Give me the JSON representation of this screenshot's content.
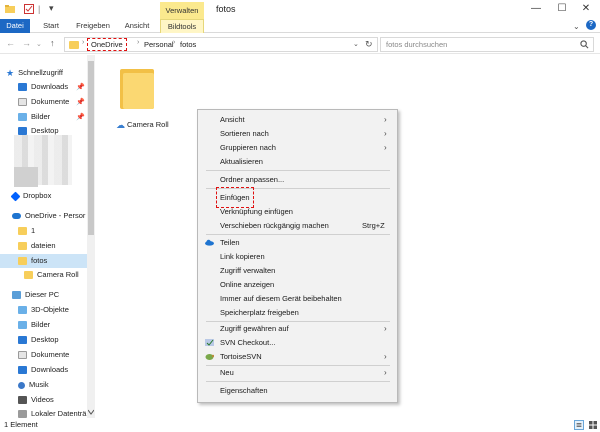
{
  "window": {
    "title": "fotos",
    "context_tab_group": "Verwalten",
    "min_symbol": "—",
    "max_symbol": "☐",
    "close_symbol": "✕"
  },
  "quick_access": {
    "sep": "|",
    "more": "▾"
  },
  "ribbon": {
    "tabs": [
      "Datei",
      "Start",
      "Freigeben",
      "Ansicht",
      "Bildtools"
    ],
    "collapse_symbol": "⌄",
    "help_symbol": "?"
  },
  "nav": {
    "back": "←",
    "forward": "→",
    "history": "⌄",
    "up": "↑"
  },
  "address": {
    "crumbs": [
      "OneDrive",
      "Personal",
      "fotos"
    ],
    "arrow": "›",
    "dropdown": "⌄",
    "refresh": "↻"
  },
  "search": {
    "placeholder": "fotos durchsuchen"
  },
  "sidebar": {
    "items": [
      {
        "label": "Schnellzugriff"
      },
      {
        "label": "Downloads"
      },
      {
        "label": "Dokumente"
      },
      {
        "label": "Bilder"
      },
      {
        "label": "Desktop"
      },
      {
        "label": "Dropbox"
      },
      {
        "label": "OneDrive - Persor"
      },
      {
        "label": "1"
      },
      {
        "label": "dateien"
      },
      {
        "label": "fotos"
      },
      {
        "label": "Camera Roll"
      },
      {
        "label": "Dieser PC"
      },
      {
        "label": "3D-Objekte"
      },
      {
        "label": "Bilder"
      },
      {
        "label": "Desktop"
      },
      {
        "label": "Dokumente"
      },
      {
        "label": "Downloads"
      },
      {
        "label": "Musik"
      },
      {
        "label": "Videos"
      },
      {
        "label": "Lokaler Datenträ"
      }
    ],
    "pin": "📌",
    "star": "★"
  },
  "content": {
    "files": [
      {
        "name": "Camera Roll"
      }
    ],
    "cloud_symbol": "☁"
  },
  "context_menu": {
    "items": [
      {
        "label": "Ansicht"
      },
      {
        "label": "Sortieren nach"
      },
      {
        "label": "Gruppieren nach"
      },
      {
        "label": "Aktualisieren"
      },
      {
        "label": "Ordner anpassen..."
      },
      {
        "label": "Einfügen"
      },
      {
        "label": "Verknüpfung einfügen"
      },
      {
        "label": "Verschieben rückgängig machen",
        "shortcut": "Strg+Z"
      },
      {
        "label": "Teilen"
      },
      {
        "label": "Link kopieren"
      },
      {
        "label": "Zugriff verwalten"
      },
      {
        "label": "Online anzeigen"
      },
      {
        "label": "Immer auf diesem Gerät beibehalten"
      },
      {
        "label": "Speicherplatz freigeben"
      },
      {
        "label": "Zugriff gewähren auf"
      },
      {
        "label": "SVN Checkout..."
      },
      {
        "label": "TortoiseSVN"
      },
      {
        "label": "Neu"
      },
      {
        "label": "Eigenschaften"
      }
    ],
    "arrow": "›"
  },
  "status": {
    "text": "1 Element"
  },
  "colors": {
    "accent": "#1c68c4",
    "highlight_dash": "#e01010",
    "folder": "#f7ce5b"
  }
}
